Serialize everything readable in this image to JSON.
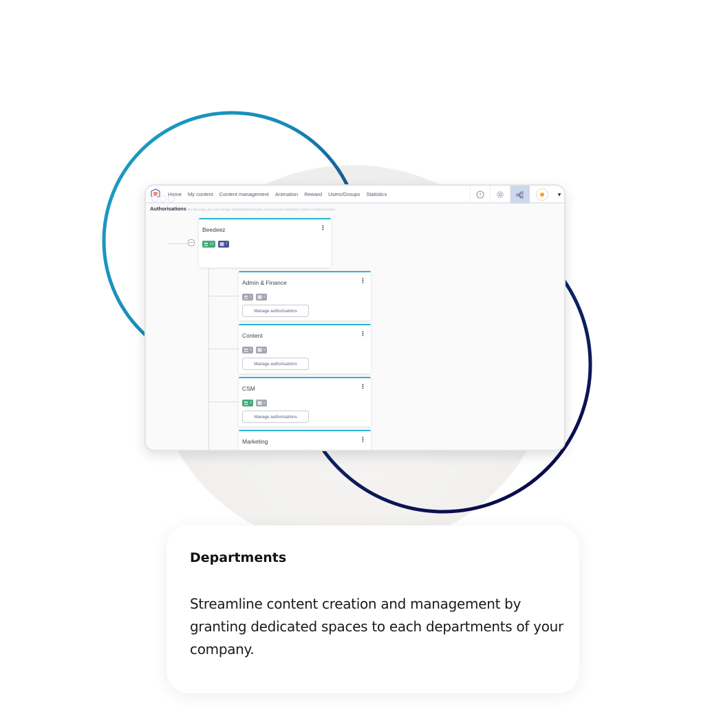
{
  "app": {
    "nav": {
      "links": [
        "Home",
        "My content",
        "Content management",
        "Animation",
        "Reward",
        "Users/Groups",
        "Statistics"
      ],
      "icons": [
        "help-icon",
        "settings-icon",
        "org-chart-icon",
        "avatar-icon",
        "caret-down-icon"
      ],
      "active_icon": "org-chart-icon"
    },
    "page": {
      "title": "Authorisations",
      "subtitle": "On this page, you can manage autorizations that give access to your company's content creation account"
    },
    "root": {
      "name": "Beedeez",
      "users_count": "53",
      "content_count": "7",
      "collapse_symbol": "−"
    },
    "departments": [
      {
        "name": "Admin & Finance",
        "users_count": "0",
        "content_count": "0",
        "button": "Manage authorisations",
        "users_active": false
      },
      {
        "name": "Content",
        "users_count": "0",
        "content_count": "0",
        "button": "Manage authorisations",
        "users_active": false
      },
      {
        "name": "CSM",
        "users_count": "2",
        "content_count": "0",
        "button": "Manage authorisations",
        "users_active": true
      },
      {
        "name": "Marketing"
      }
    ],
    "kebab_symbol": "⋮",
    "colors": {
      "accent": "#2bb6d6",
      "users_badge_active": "#3eaa78",
      "content_badge_root": "#4a4f98",
      "badge_inactive": "#a2a6b0",
      "ring_light": "#1aa0c4",
      "ring_dark": "#0b0c4f"
    }
  },
  "feature": {
    "title": "Departments",
    "description": "Streamline content creation and management by granting dedicated spaces to each departments of your company."
  }
}
